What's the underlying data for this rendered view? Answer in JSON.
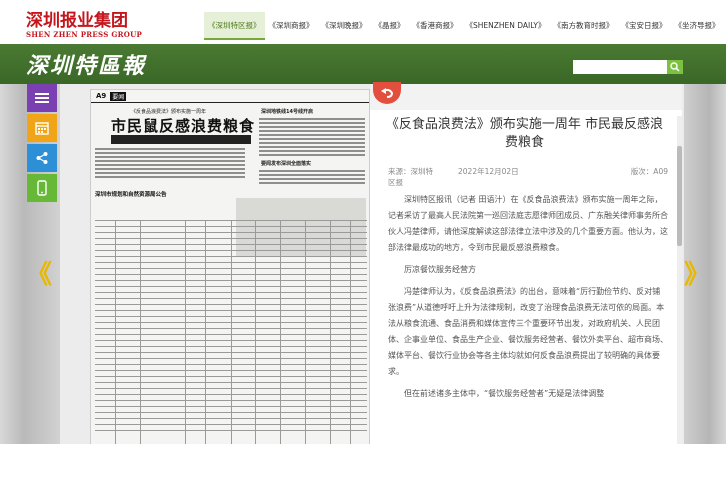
{
  "header": {
    "logo_cn": "深圳报业集团",
    "logo_en": "SHEN ZHEN PRESS GROUP",
    "nav": [
      {
        "label": "《深圳特区报》",
        "active": true
      },
      {
        "label": "《深圳商报》",
        "active": false
      },
      {
        "label": "《深圳晚报》",
        "active": false
      },
      {
        "label": "《晶报》",
        "active": false
      },
      {
        "label": "《香港商报》",
        "active": false
      },
      {
        "label": "《SHENZHEN DAILY》",
        "active": false
      },
      {
        "label": "《南方教育时报》",
        "active": false
      },
      {
        "label": "《宝安日报》",
        "active": false
      },
      {
        "label": "《坐济导报》",
        "active": false
      }
    ]
  },
  "band": {
    "brand": "深圳特區報",
    "search_placeholder": "",
    "search_icon": "search-icon"
  },
  "side_buttons": [
    {
      "icon": "menu-icon",
      "color": "#7a3fb0"
    },
    {
      "icon": "calendar-icon",
      "color": "#f0a418"
    },
    {
      "icon": "share-icon",
      "color": "#2d8fd6"
    },
    {
      "icon": "mobile-icon",
      "color": "#66b836"
    }
  ],
  "nav_arrows": {
    "prev": "《",
    "next": "》"
  },
  "paper": {
    "page_no": "A9",
    "section": "要闻",
    "kicker": "《反食品浪费法》颁布实施一周年",
    "headline": "市民鼠反感浪费粮食",
    "right_title_1": "深圳地铁线14号线开启",
    "right_title_2": "要闻发布深圳全面落实",
    "big_title": "深圳市规划和自然资源局公告"
  },
  "article": {
    "title": "《反食品浪费法》颁布实施一周年 市民最反感浪费粮食",
    "source": "来源：深圳特区报",
    "date": "2022年12月02日",
    "edition": "版次：A09",
    "paragraphs": [
      "深圳特区报讯（记者 田语汁）在《反食品浪费法》颁布实施一周年之际，记者采访了最高人民法院第一巡回法庭志愿律师团成员、广东融关律师事务所合伙人冯楚律师，请他深度解读这部法律立法中涉及的几个重要方面。他认为，这部法律最成功的地方，令到市民最反感浪费粮食。",
      "厉凉餐饮服务经营方",
      "冯楚律师认为，《反食品浪费法》的出台，意味着“厉行勤俭节约、反对铺张浪费”从道德呼吁上升为法律规制，改变了治理食品浪费无法可依的局面。本法从粮食流通、食品消费和媒体宣传三个重要环节出发，对政府机关、人民团体、企事业单位、食品生产企业、餐饮服务经营者、餐饮外卖平台、超市商场、媒体平台、餐饮行业协会等各主体均就如何反食品浪费提出了较明确的具体要求。",
      "但在前述诸多主体中，“餐饮服务经营者”无疑是法律调整"
    ]
  }
}
